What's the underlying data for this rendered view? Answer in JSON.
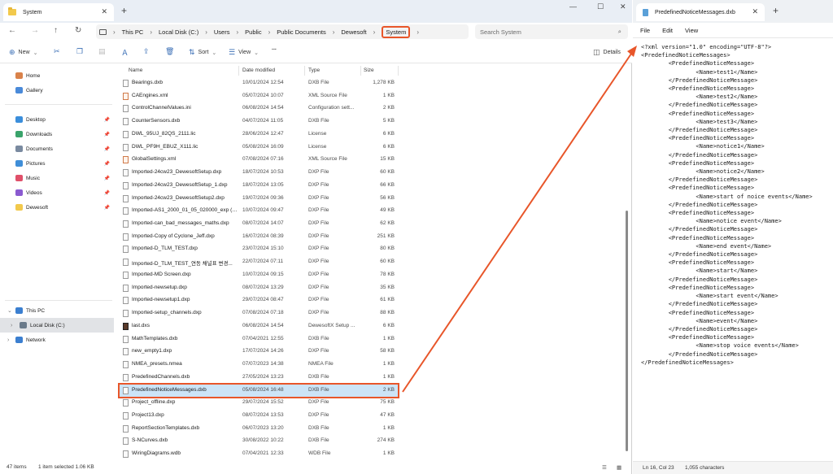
{
  "explorer": {
    "tab_title": "System",
    "window_controls": [
      "—",
      "☐",
      "✕"
    ],
    "breadcrumb": [
      "This PC",
      "Local Disk (C:)",
      "Users",
      "Public",
      "Public Documents",
      "Dewesoft",
      "System"
    ],
    "search_placeholder": "Search System",
    "toolbar": {
      "new": "New",
      "sort": "Sort",
      "view": "View",
      "more": "...",
      "details": "Details"
    },
    "sidebar": {
      "quick": [
        {
          "label": "Home",
          "color": "#d9824a",
          "pinned": false
        },
        {
          "label": "Gallery",
          "color": "#4a8ad9",
          "pinned": false
        }
      ],
      "pinned": [
        {
          "label": "Desktop",
          "color": "#3b8edb"
        },
        {
          "label": "Downloads",
          "color": "#3aa36b"
        },
        {
          "label": "Documents",
          "color": "#7a8aa0"
        },
        {
          "label": "Pictures",
          "color": "#3f8ed8"
        },
        {
          "label": "Music",
          "color": "#e0506a"
        },
        {
          "label": "Videos",
          "color": "#8a5ad0"
        },
        {
          "label": "Dewesoft",
          "color": "#f2c94c"
        }
      ],
      "tree": [
        {
          "label": "This PC",
          "color": "#3b7fd0"
        },
        {
          "label": "Local Disk (C:)",
          "color": "#6a7a8a"
        },
        {
          "label": "Network",
          "color": "#3b7fd0"
        }
      ]
    },
    "columns": [
      "Name",
      "Date modified",
      "Type",
      "Size"
    ],
    "files": [
      [
        "Bearings.dxb",
        "10/01/2024 12:54",
        "DXB File",
        "1,278 KB",
        "file"
      ],
      [
        "CAEngines.xml",
        "05/07/2024 10:07",
        "XML Source File",
        "1 KB",
        "xml"
      ],
      [
        "ControlChannelValues.ini",
        "06/08/2024 14:54",
        "Configuration sett...",
        "2 KB",
        "file"
      ],
      [
        "CounterSensors.dxb",
        "04/07/2024 11:05",
        "DXB File",
        "5 KB",
        "file"
      ],
      [
        "DWL_95UJ_82QS_2111.lic",
        "28/06/2024 12:47",
        "License",
        "6 KB",
        "file"
      ],
      [
        "DWL_PF9H_EBUZ_X111.lic",
        "05/08/2024 16:09",
        "License",
        "6 KB",
        "file"
      ],
      [
        "GlobalSettings.xml",
        "07/08/2024 07:16",
        "XML Source File",
        "15 KB",
        "xml"
      ],
      [
        "Imported-24cw23_DewesoftSetup.dxp",
        "18/07/2024 10:53",
        "DXP File",
        "60 KB",
        "file"
      ],
      [
        "Imported-24cw23_DewesoftSetup_1.dxp",
        "18/07/2024 13:05",
        "DXP File",
        "66 KB",
        "file"
      ],
      [
        "Imported-24cw23_DewesoftSetup2.dxp",
        "19/07/2024 09:36",
        "DXP File",
        "56 KB",
        "file"
      ],
      [
        "Imported-AS1_2000_01_05_020000_exp (1...",
        "10/07/2024 09:47",
        "DXP File",
        "49 KB",
        "file"
      ],
      [
        "Imported-can_bad_messages_maths.dxp",
        "08/07/2024 14:07",
        "DXP File",
        "62 KB",
        "file"
      ],
      [
        "Imported-Copy of Cyclone_Jeff.dxp",
        "16/07/2024 08:39",
        "DXP File",
        "251 KB",
        "file"
      ],
      [
        "Imported-D_TLM_TEST.dxp",
        "23/07/2024 15:10",
        "DXP File",
        "80 KB",
        "file"
      ],
      [
        "Imported-D_TLM_TEST_연동 채널표 변경...",
        "22/07/2024 07:11",
        "DXP File",
        "60 KB",
        "file"
      ],
      [
        "Imported-MD Screen.dxp",
        "10/07/2024 09:15",
        "DXP File",
        "78 KB",
        "file"
      ],
      [
        "Imported-newsetup.dxp",
        "08/07/2024 13:29",
        "DXP File",
        "35 KB",
        "file"
      ],
      [
        "Imported-newsetup1.dxp",
        "29/07/2024 08:47",
        "DXP File",
        "61 KB",
        "file"
      ],
      [
        "Imported-setup_channels.dxp",
        "07/08/2024 07:18",
        "DXP File",
        "88 KB",
        "file"
      ],
      [
        "last.dxs",
        "06/08/2024 14:54",
        "DewesoftX Setup ...",
        "6 KB",
        "dxs"
      ],
      [
        "MathTemplates.dxb",
        "07/04/2021 12:55",
        "DXB File",
        "1 KB",
        "file"
      ],
      [
        "new_empty1.dxp",
        "17/07/2024 14:26",
        "DXP File",
        "58 KB",
        "file"
      ],
      [
        "NMEA_presets.nmea",
        "07/07/2023 14:38",
        "NMEA File",
        "1 KB",
        "file"
      ],
      [
        "PredefinedChannels.dxb",
        "27/05/2024 13:23",
        "DXB File",
        "1 KB",
        "file"
      ],
      [
        "PredefinedNoticeMessages.dxb",
        "05/08/2024 16:48",
        "DXB File",
        "2 KB",
        "file"
      ],
      [
        "Project_offline.dxp",
        "29/07/2024 15:52",
        "DXP File",
        "75 KB",
        "file"
      ],
      [
        "Project13.dxp",
        "08/07/2024 13:53",
        "DXP File",
        "47 KB",
        "file"
      ],
      [
        "ReportSectionTemplates.dxb",
        "06/07/2023 13:20",
        "DXB File",
        "1 KB",
        "file"
      ],
      [
        "S-NCurves.dxb",
        "30/08/2022 10:22",
        "DXB File",
        "274 KB",
        "file"
      ],
      [
        "WiringDiagrams.wdb",
        "07/04/2021 12:33",
        "WDB File",
        "1 KB",
        "file"
      ]
    ],
    "status": {
      "items": "47 items",
      "selected": "1 item selected  1.06 KB"
    }
  },
  "notepad": {
    "tab_title": "PredefinedNoticeMessages.dxb",
    "menu": [
      "File",
      "Edit",
      "View"
    ],
    "lines": [
      "<?xml version=\"1.0\" encoding=\"UTF-8\"?>",
      "<PredefinedNoticeMessages>",
      "        <PredefinedNoticeMessage>",
      "                <Name>test1</Name>",
      "        </PredefinedNoticeMessage>",
      "        <PredefinedNoticeMessage>",
      "                <Name>test2</Name>",
      "        </PredefinedNoticeMessage>",
      "        <PredefinedNoticeMessage>",
      "                <Name>test3</Name>",
      "        </PredefinedNoticeMessage>",
      "        <PredefinedNoticeMessage>",
      "                <Name>notice1</Name>",
      "        </PredefinedNoticeMessage>",
      "        <PredefinedNoticeMessage>",
      "                <Name>notice2</Name>",
      "        </PredefinedNoticeMessage>",
      "        <PredefinedNoticeMessage>",
      "                <Name>start of noice events</Name>",
      "        </PredefinedNoticeMessage>",
      "        <PredefinedNoticeMessage>",
      "                <Name>notice event</Name>",
      "        </PredefinedNoticeMessage>",
      "        <PredefinedNoticeMessage>",
      "                <Name>end event</Name>",
      "        </PredefinedNoticeMessage>",
      "        <PredefinedNoticeMessage>",
      "                <Name>start</Name>",
      "        </PredefinedNoticeMessage>",
      "        <PredefinedNoticeMessage>",
      "                <Name>start event</Name>",
      "        </PredefinedNoticeMessage>",
      "        <PredefinedNoticeMessage>",
      "                <Name>event</Name>",
      "        </PredefinedNoticeMessage>",
      "        <PredefinedNoticeMessage>",
      "                <Name>stop voice events</Name>",
      "        </PredefinedNoticeMessage>",
      "</PredefinedNoticeMessages>"
    ],
    "status": {
      "position": "Ln 16, Col 23",
      "chars": "1,055 characters"
    }
  },
  "colors": {
    "annotation": "#e8562a",
    "selection": "#cce4f7"
  }
}
